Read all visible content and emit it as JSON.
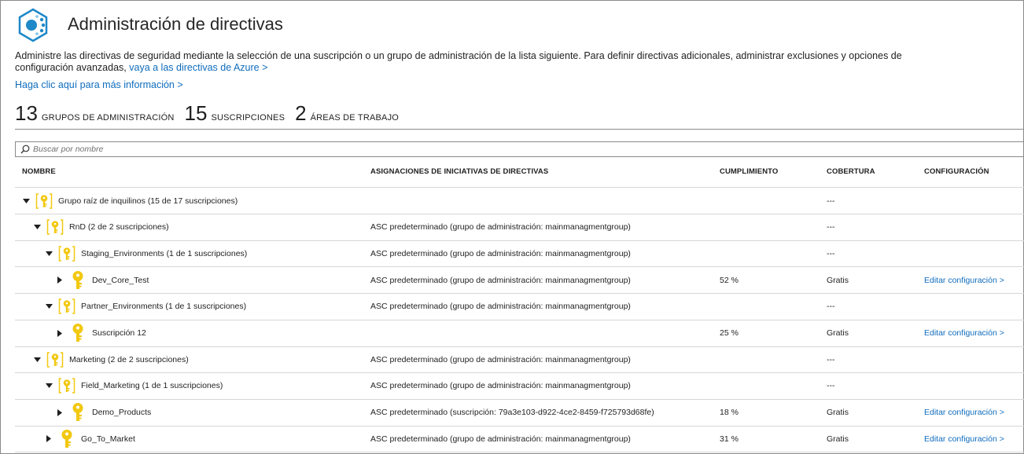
{
  "header": {
    "title": "Administración de directivas",
    "description": "Administre las directivas de seguridad mediante la selección de una suscripción o un grupo de administración de la lista siguiente. Para definir directivas adicionales, administrar exclusiones y opciones de configuración avanzadas,",
    "azure_link": "vaya a las directivas de Azure >",
    "more_info_link": "Haga clic aquí para más información >"
  },
  "stats": [
    {
      "count": "13",
      "label": "GRUPOS DE ADMINISTRACIÓN"
    },
    {
      "count": "15",
      "label": "SUSCRIPCIONES"
    },
    {
      "count": "2",
      "label": "ÁREAS DE TRABAJO"
    }
  ],
  "search": {
    "placeholder": "Buscar por nombre"
  },
  "columns": {
    "name": "NOMBRE",
    "assignments": "ASIGNACIONES DE INICIATIVAS DE DIRECTIVAS",
    "compliance": "CUMPLIMIENTO",
    "coverage": "COBERTURA",
    "settings": "CONFIGURACIÓN"
  },
  "rows": [
    {
      "name": "Grupo raíz de inquilinos (15 de 17 suscripciones)",
      "type": "group",
      "level": 0,
      "expanded": true,
      "assignment": "",
      "compliance": "",
      "coverage": "---",
      "settings": ""
    },
    {
      "name": "RnD (2 de 2 suscripciones)",
      "type": "group",
      "level": 1,
      "expanded": true,
      "assignment": "ASC predeterminado (grupo de administración: mainmanagmentgroup)",
      "compliance": "",
      "coverage": "---",
      "settings": ""
    },
    {
      "name": "Staging_Environments (1 de 1 suscripciones)",
      "type": "group",
      "level": 2,
      "expanded": true,
      "assignment": "ASC predeterminado (grupo de administración: mainmanagmentgroup)",
      "compliance": "",
      "coverage": "---",
      "settings": ""
    },
    {
      "name": "Dev_Core_Test",
      "type": "subscription",
      "level": 3,
      "expanded": false,
      "assignment": "ASC predeterminado (grupo de administración: mainmanagmentgroup)",
      "compliance": "52 %",
      "coverage": "Gratis",
      "settings": "Editar configuración >"
    },
    {
      "name": "Partner_Environments (1 de 1 suscripciones)",
      "type": "group",
      "level": 2,
      "expanded": true,
      "assignment": "ASC predeterminado (grupo de administración: mainmanagmentgroup)",
      "compliance": "",
      "coverage": "---",
      "settings": ""
    },
    {
      "name": "Suscripción 12",
      "type": "subscription",
      "level": 3,
      "expanded": false,
      "assignment": "",
      "compliance": "25 %",
      "coverage": "Gratis",
      "settings": "Editar configuración >"
    },
    {
      "name": "Marketing (2 de 2 suscripciones)",
      "type": "group",
      "level": 1,
      "expanded": true,
      "assignment": "ASC predeterminado (grupo de administración: mainmanagmentgroup)",
      "compliance": "",
      "coverage": "---",
      "settings": ""
    },
    {
      "name": "Field_Marketing (1 de 1 suscripciones)",
      "type": "group",
      "level": 2,
      "expanded": true,
      "assignment": "ASC predeterminado (grupo de administración: mainmanagmentgroup)",
      "compliance": "",
      "coverage": "---",
      "settings": ""
    },
    {
      "name": "Demo_Products",
      "type": "subscription",
      "level": 3,
      "expanded": false,
      "assignment": "ASC predeterminado (suscripción: 79a3e103-d922-4ce2-8459-f725793d68fe)",
      "compliance": "18 %",
      "coverage": "Gratis",
      "settings": "Editar configuración >"
    },
    {
      "name": "Go_To_Market",
      "type": "subscription",
      "level": 2,
      "expanded": false,
      "assignment": "ASC predeterminado (grupo de administración: mainmanagmentgroup)",
      "compliance": "31 %",
      "coverage": "Gratis",
      "settings": "Editar configuración >"
    }
  ],
  "colors": {
    "link": "#0f6cbd",
    "key_yellow": "#f2c811",
    "brand_blue": "#1e88c9"
  }
}
